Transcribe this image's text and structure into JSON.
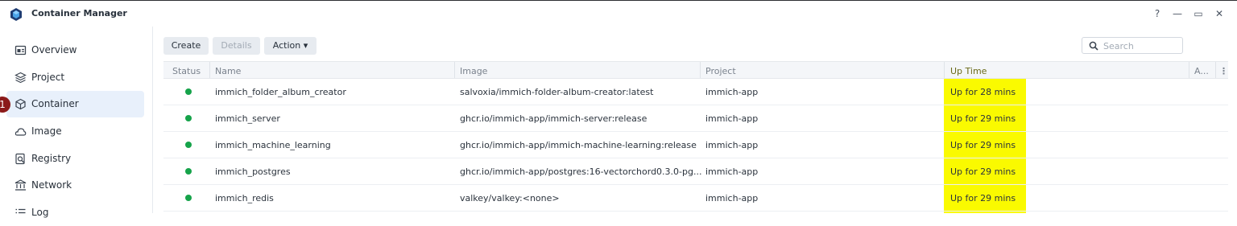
{
  "app": {
    "title": "Container Manager"
  },
  "window_controls": {
    "help": "?",
    "minimize": "—",
    "maximize": "▭",
    "close": "✕"
  },
  "sidebar": {
    "items": [
      {
        "label": "Overview",
        "icon": "overview-icon"
      },
      {
        "label": "Project",
        "icon": "project-icon"
      },
      {
        "label": "Container",
        "icon": "container-icon",
        "active": true
      },
      {
        "label": "Image",
        "icon": "image-icon"
      },
      {
        "label": "Registry",
        "icon": "registry-icon"
      },
      {
        "label": "Network",
        "icon": "network-icon"
      },
      {
        "label": "Log",
        "icon": "log-icon"
      }
    ],
    "badge": "1"
  },
  "toolbar": {
    "create_label": "Create",
    "details_label": "Details",
    "action_label": "Action ▾",
    "search_placeholder": "Search"
  },
  "table": {
    "columns": [
      "Status",
      "Name",
      "Image",
      "Project",
      "Up Time",
      "A..."
    ],
    "rows": [
      {
        "status": "running",
        "name": "immich_folder_album_creator",
        "image": "salvoxia/immich-folder-album-creator:latest",
        "project": "immich-app",
        "uptime": "Up for 28 mins"
      },
      {
        "status": "running",
        "name": "immich_server",
        "image": "ghcr.io/immich-app/immich-server:release",
        "project": "immich-app",
        "uptime": "Up for 29 mins"
      },
      {
        "status": "running",
        "name": "immich_machine_learning",
        "image": "ghcr.io/immich-app/immich-machine-learning:release",
        "project": "immich-app",
        "uptime": "Up for 29 mins"
      },
      {
        "status": "running",
        "name": "immich_postgres",
        "image": "ghcr.io/immich-app/postgres:16-vectorchord0.3.0-pg...",
        "project": "immich-app",
        "uptime": "Up for 29 mins"
      },
      {
        "status": "running",
        "name": "immich_redis",
        "image": "valkey/valkey:<none>",
        "project": "immich-app",
        "uptime": "Up for 29 mins"
      }
    ]
  },
  "colors": {
    "highlight": "#fafa00",
    "status_running": "#16a34a",
    "badge": "#8b1a1a",
    "active_nav": "#e8f0fb"
  }
}
